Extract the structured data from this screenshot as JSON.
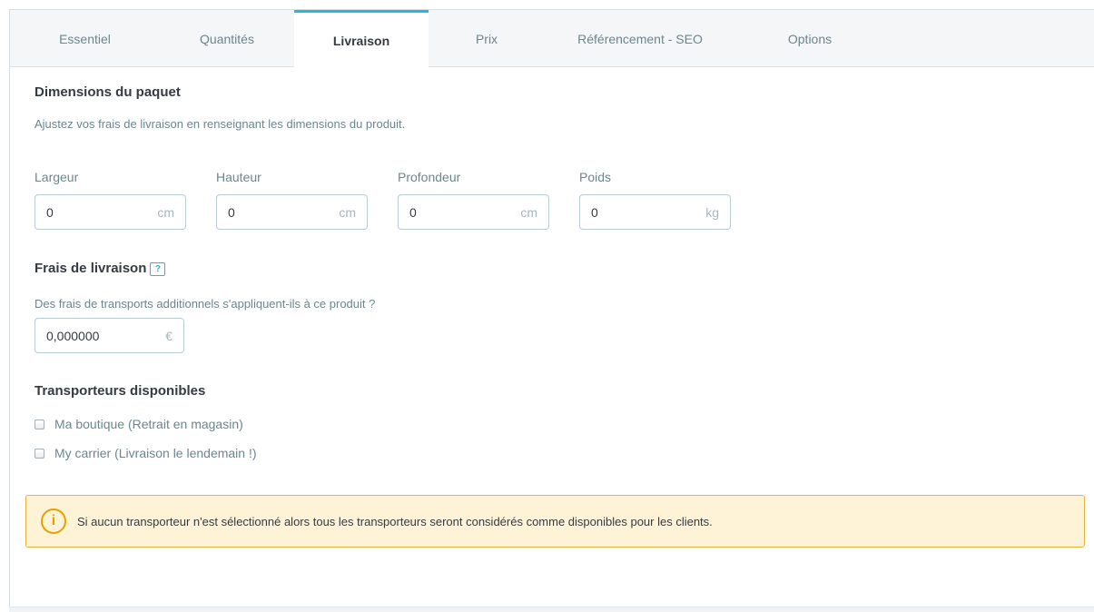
{
  "tabs": [
    {
      "label": "Essentiel"
    },
    {
      "label": "Quantités"
    },
    {
      "label": "Livraison"
    },
    {
      "label": "Prix"
    },
    {
      "label": "Référencement - SEO"
    },
    {
      "label": "Options"
    }
  ],
  "active_tab": "Livraison",
  "package": {
    "title": "Dimensions du paquet",
    "description": "Ajustez vos frais de livraison en renseignant les dimensions du produit.",
    "fields": [
      {
        "label": "Largeur",
        "value": "0",
        "unit": "cm"
      },
      {
        "label": "Hauteur",
        "value": "0",
        "unit": "cm"
      },
      {
        "label": "Profondeur",
        "value": "0",
        "unit": "cm"
      },
      {
        "label": "Poids",
        "value": "0",
        "unit": "kg"
      }
    ]
  },
  "shipping_fees": {
    "title": "Frais de livraison",
    "help_icon": "?",
    "question": "Des frais de transports additionnels s'appliquent-ils à ce produit ?",
    "value": "0,000000",
    "unit": "€"
  },
  "carriers": {
    "title": "Transporteurs disponibles",
    "items": [
      {
        "label": "Ma boutique (Retrait en magasin)",
        "checked": false
      },
      {
        "label": "My carrier (Livraison le lendemain !)",
        "checked": false
      }
    ]
  },
  "alert": {
    "icon": "i",
    "text": "Si aucun transporteur n'est sélectionné alors tous les transporteurs seront considérés comme disponibles pour les clients."
  },
  "colors": {
    "accent": "#25b9d7",
    "warning_bg": "#fff3d7",
    "warning_border": "#e8b440"
  }
}
